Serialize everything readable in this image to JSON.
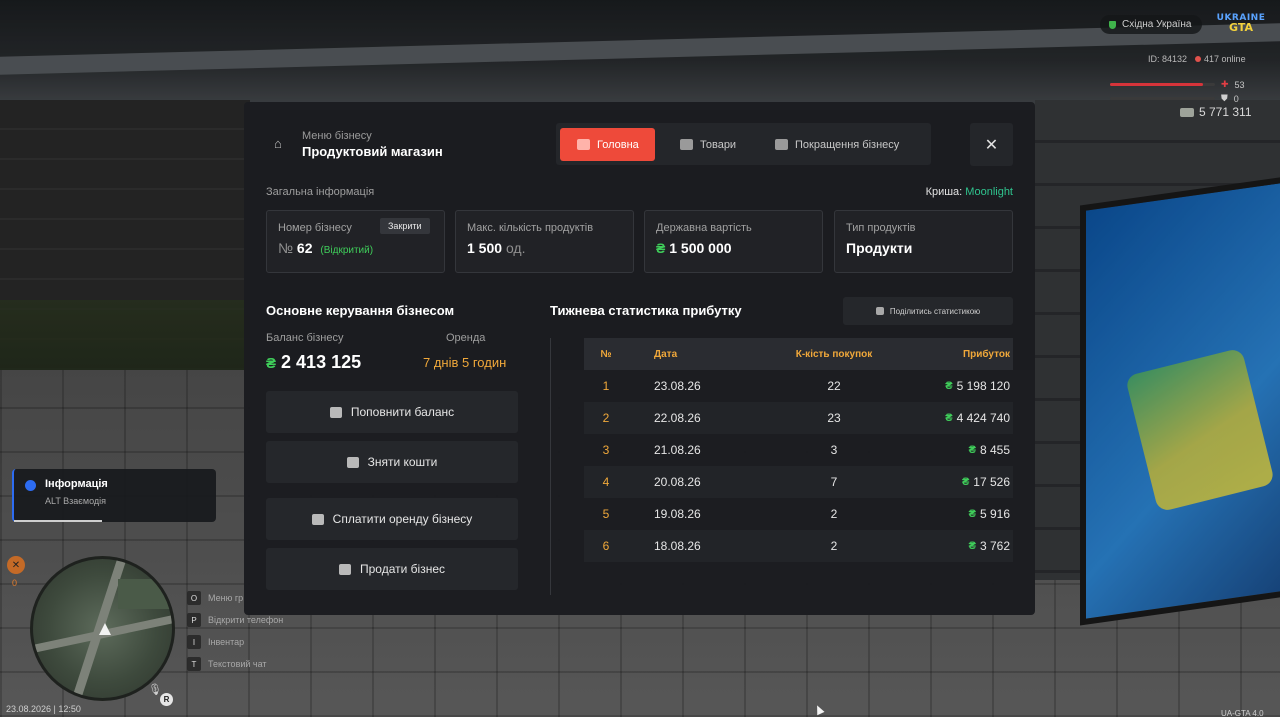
{
  "hud": {
    "region": "Східна Україна",
    "logo_line1": "UKRAINE",
    "logo_line2": "GTA",
    "player_id": "ID: 84132",
    "online": "417 online",
    "health": "53",
    "armor": "0",
    "money": "5 771 311"
  },
  "notification": {
    "title": "Інформація",
    "subtitle": "ALT Взаємодія"
  },
  "hud_left": {
    "hunger": "0",
    "datetime": "23.08.2026 | 12:50",
    "voice_key": "R",
    "hints": [
      {
        "key": "O",
        "label": "Меню гр"
      },
      {
        "key": "P",
        "label": "Відкрити телефон"
      },
      {
        "key": "I",
        "label": "Інвентар"
      },
      {
        "key": "T",
        "label": "Текстовий чат"
      }
    ],
    "version": "UA-GTA 4.0"
  },
  "modal": {
    "subtitle": "Меню бізнесу",
    "title": "Продуктовий магазин",
    "tabs": [
      {
        "label": "Головна",
        "icon": "home-icon",
        "active": true
      },
      {
        "label": "Товари",
        "icon": "basket-icon",
        "active": false
      },
      {
        "label": "Покращення бізнесу",
        "icon": "upgrade-icon",
        "active": false
      }
    ],
    "close_symbol": "✕",
    "general_label": "Загальна інформація",
    "roof_label": "Криша:",
    "roof_value": "Moonlight",
    "cards": {
      "number": {
        "label": "Номер бізнесу",
        "prefix": "№",
        "value": "62",
        "status": "(Відкритий)",
        "button": "Закрити"
      },
      "max_products": {
        "label": "Макс. кількість продуктів",
        "value": "1 500",
        "unit": "од."
      },
      "state_value": {
        "label": "Державна вартість",
        "currency": "₴",
        "value": "1 500 000"
      },
      "product_type": {
        "label": "Тип продуктів",
        "value": "Продукти"
      }
    },
    "management": {
      "title": "Основне керування бізнесом",
      "balance_label": "Баланс бізнесу",
      "balance_currency": "₴",
      "balance_value": "2 413 125",
      "rent_label": "Оренда",
      "rent_value": "7 днів 5 годин",
      "actions": [
        {
          "label": "Поповнити баланс",
          "icon": "deposit-icon"
        },
        {
          "label": "Зняти кошти",
          "icon": "withdraw-icon"
        },
        {
          "label": "Сплатити оренду бізнесу",
          "icon": "users-icon"
        },
        {
          "label": "Продати бізнес",
          "icon": "sell-icon"
        }
      ]
    },
    "stats": {
      "title": "Тижнева статистика прибутку",
      "share_label": "Поділитись статистикою",
      "headers": {
        "num": "№",
        "date": "Дата",
        "count": "К-кість покупок",
        "profit": "Прибуток"
      },
      "currency": "₴",
      "rows": [
        {
          "num": "1",
          "date": "23.08.26",
          "count": "22",
          "profit": "5 198 120"
        },
        {
          "num": "2",
          "date": "22.08.26",
          "count": "23",
          "profit": "4 424 740"
        },
        {
          "num": "3",
          "date": "21.08.26",
          "count": "3",
          "profit": "8 455"
        },
        {
          "num": "4",
          "date": "20.08.26",
          "count": "7",
          "profit": "17 526"
        },
        {
          "num": "5",
          "date": "19.08.26",
          "count": "2",
          "profit": "5 916"
        },
        {
          "num": "6",
          "date": "18.08.26",
          "count": "2",
          "profit": "3 762"
        }
      ]
    }
  }
}
